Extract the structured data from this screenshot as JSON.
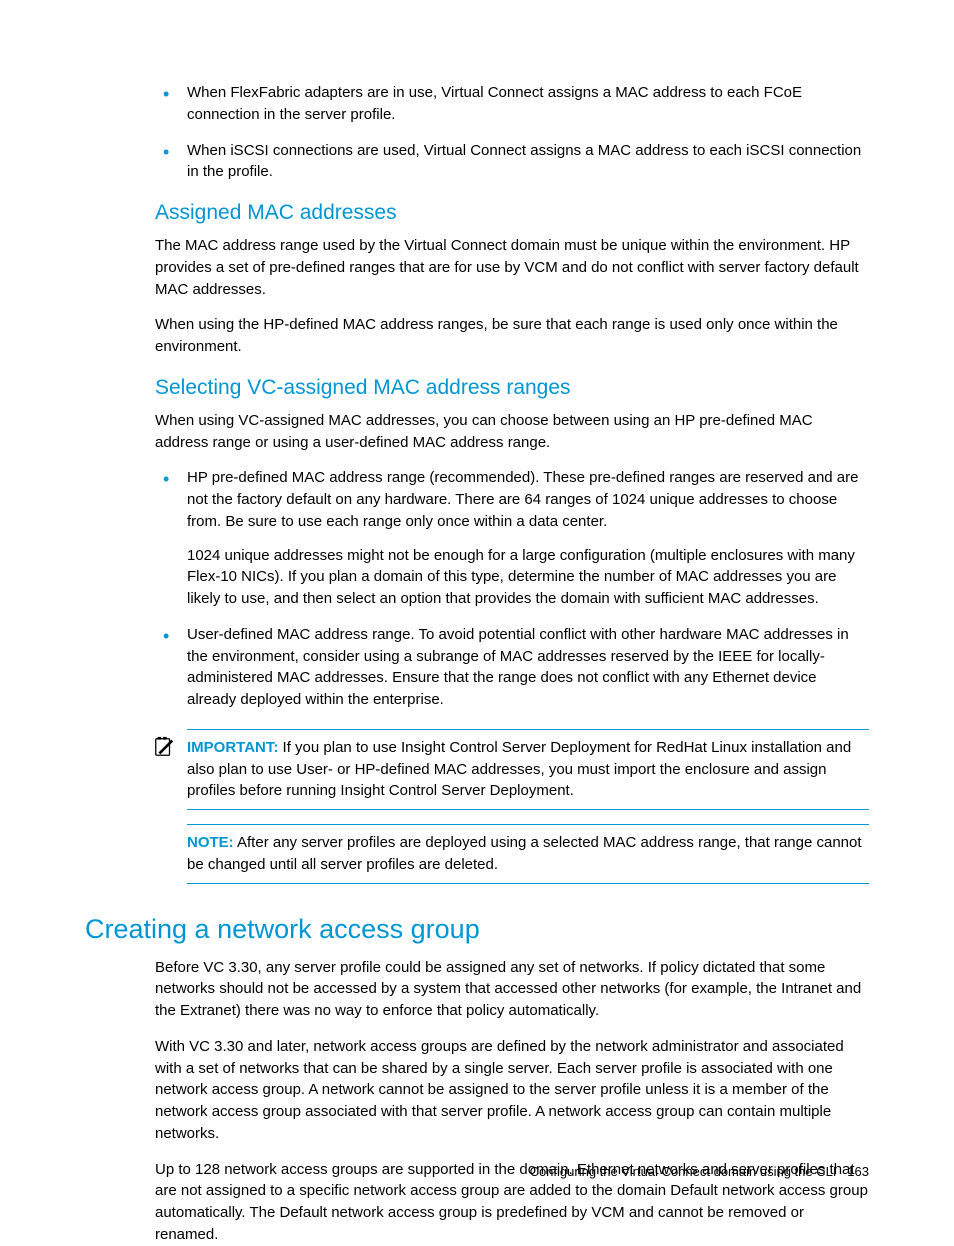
{
  "topBullets": [
    "When FlexFabric adapters are in use, Virtual Connect assigns a MAC address to each FCoE connection in the server profile.",
    "When iSCSI connections are used, Virtual Connect assigns a MAC address to each iSCSI connection in the profile."
  ],
  "section1": {
    "heading": "Assigned MAC addresses",
    "p1": "The MAC address range used by the Virtual Connect domain must be unique within the environment. HP provides a set of pre-defined ranges that are for use by VCM and do not conflict with server factory default MAC addresses.",
    "p2": "When using the HP-defined MAC address ranges, be sure that each range is used only once within the environment."
  },
  "section2": {
    "heading": "Selecting VC-assigned MAC address ranges",
    "p1": "When using VC-assigned MAC addresses, you can choose between using an HP pre-defined MAC address range or using a user-defined MAC address range.",
    "bullets": [
      {
        "main": "HP pre-defined MAC address range (recommended). These pre-defined ranges are reserved and are not the factory default on any hardware. There are 64 ranges of 1024 unique addresses to choose from. Be sure to use each range only once within a data center.",
        "sub": "1024 unique addresses might not be enough for a large configuration (multiple enclosures with many Flex-10 NICs). If you plan a domain of this type, determine the number of MAC addresses you are likely to use, and then select an option that provides the domain with sufficient MAC addresses."
      },
      {
        "main": "User-defined MAC address range. To avoid potential conflict with other hardware MAC addresses in the environment, consider using a subrange of MAC addresses reserved by the IEEE for locally-administered MAC addresses. Ensure that the range does not conflict with any Ethernet device already deployed within the enterprise."
      }
    ],
    "important": {
      "label": "IMPORTANT:",
      "text": " If you plan to use Insight Control Server Deployment for RedHat Linux installation and also plan to use User- or HP-defined MAC addresses, you must import the enclosure and assign profiles before running Insight Control Server Deployment."
    },
    "note": {
      "label": "NOTE:",
      "text": " After any server profiles are deployed using a selected MAC address range, that range cannot be changed until all server profiles are deleted."
    }
  },
  "section3": {
    "heading": "Creating a network access group",
    "p1": "Before VC 3.30, any server profile could be assigned any set of networks. If policy dictated that some networks should not be accessed by a system that accessed other networks (for example, the Intranet and the Extranet) there was no way to enforce that policy automatically.",
    "p2": "With VC 3.30 and later, network access groups are defined by the network administrator and associated with a set of networks that can be shared by a single server. Each server profile is associated with one network access group. A network cannot be assigned to the server profile unless it is a member of the network access group associated with that server profile. A network access group can contain multiple networks.",
    "p3": "Up to 128 network access groups are supported in the domain. Ethernet networks and server profiles that are not assigned to a specific network access group are added to the domain Default network access group automatically. The Default network access group is predefined by VCM and cannot be removed or renamed."
  },
  "footer": {
    "text": "Configuring the Virtual Connect domain using the CLI",
    "page": "163"
  }
}
